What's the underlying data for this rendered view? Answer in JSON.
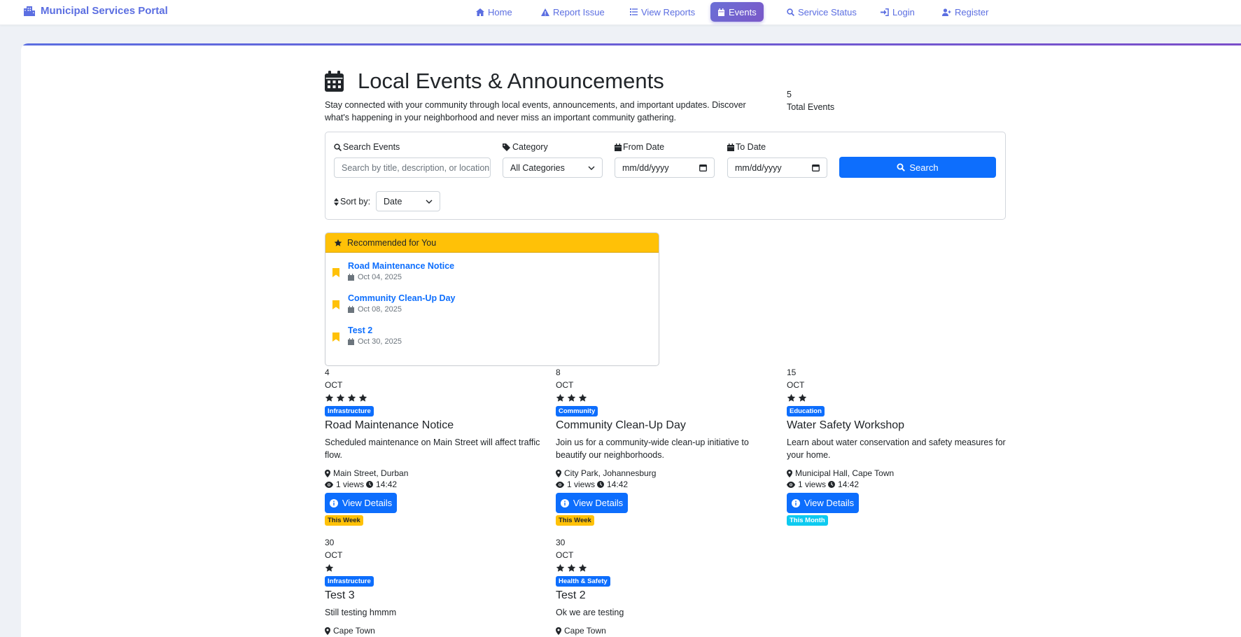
{
  "nav": {
    "brand": "Municipal Services Portal",
    "items": [
      {
        "label": "Home",
        "icon": "home-icon"
      },
      {
        "label": "Report Issue",
        "icon": "warning-icon"
      },
      {
        "label": "View Reports",
        "icon": "list-icon"
      },
      {
        "label": "Events",
        "icon": "calendar-icon",
        "active": true
      },
      {
        "label": "Service Status",
        "icon": "search-icon"
      },
      {
        "label": "Login",
        "icon": "login-icon"
      },
      {
        "label": "Register",
        "icon": "user-plus-icon"
      }
    ]
  },
  "header": {
    "title": "Local Events & Announcements",
    "subtitle": "Stay connected with your community through local events, announcements, and important updates. Discover what's happening in your neighborhood and never miss an important community gathering.",
    "stat_value": "5",
    "stat_label": "Total Events"
  },
  "filters": {
    "search_label": "Search Events",
    "search_placeholder": "Search by title, description, or location",
    "category_label": "Category",
    "category_value": "All Categories",
    "from_label": "From Date",
    "from_value": "mm/dd/yyyy",
    "to_label": "To Date",
    "to_value": "mm/dd/yyyy",
    "search_button": "Search",
    "sort_label": "Sort by:",
    "sort_value": "Date"
  },
  "recommended": {
    "heading": "Recommended for You",
    "items": [
      {
        "title": "Road Maintenance Notice",
        "date": "Oct 04, 2025"
      },
      {
        "title": "Community Clean-Up Day",
        "date": "Oct 08, 2025"
      },
      {
        "title": "Test 2",
        "date": "Oct 30, 2025"
      }
    ]
  },
  "events": [
    {
      "day": "4",
      "month": "OCT",
      "stars": 4,
      "category": "Infrastructure",
      "title": "Road Maintenance Notice",
      "description": "Scheduled maintenance on Main Street will affect traffic flow.",
      "location": "Main Street, Durban",
      "views": "1 views",
      "time": "14:42",
      "button": "View Details",
      "when": "This Week",
      "when_type": "week"
    },
    {
      "day": "8",
      "month": "OCT",
      "stars": 3,
      "category": "Community",
      "title": "Community Clean-Up Day",
      "description": "Join us for a community-wide clean-up initiative to beautify our neighborhoods.",
      "location": "City Park, Johannesburg",
      "views": "1 views",
      "time": "14:42",
      "button": "View Details",
      "when": "This Week",
      "when_type": "week"
    },
    {
      "day": "15",
      "month": "OCT",
      "stars": 2,
      "category": "Education",
      "title": "Water Safety Workshop",
      "description": "Learn about water conservation and safety measures for your home.",
      "location": "Municipal Hall, Cape Town",
      "views": "1 views",
      "time": "14:42",
      "button": "View Details",
      "when": "This Month",
      "when_type": "month"
    },
    {
      "day": "30",
      "month": "OCT",
      "stars": 1,
      "category": "Infrastructure",
      "title": "Test 3",
      "description": "Still testing hmmm",
      "location": "Cape Town"
    },
    {
      "day": "30",
      "month": "OCT",
      "stars": 3,
      "category": "Health & Safety",
      "title": "Test 2",
      "description": "Ok we are testing",
      "location": "Cape Town"
    }
  ],
  "colors": {
    "brand": "#5b6ee1",
    "primary": "#0d6efd",
    "warning": "#ffc107",
    "info": "#0dcaf0"
  }
}
